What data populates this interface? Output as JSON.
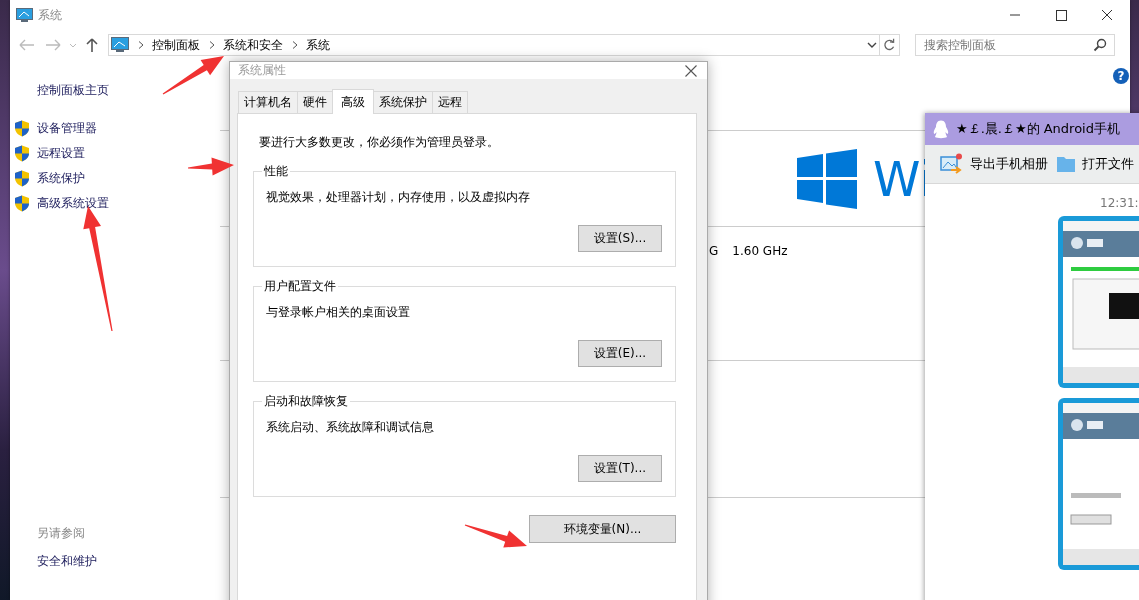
{
  "main_window": {
    "title": "系统",
    "breadcrumb": [
      "控制面板",
      "系统和安全",
      "系统"
    ],
    "search": {
      "placeholder": "搜索控制面板"
    },
    "help": "?",
    "sidebar": {
      "home": "控制面板主页",
      "items": [
        {
          "label": "设备管理器"
        },
        {
          "label": "远程设置"
        },
        {
          "label": "系统保护"
        },
        {
          "label": "高级系统设置"
        }
      ],
      "see_also": "另请参阅",
      "links": [
        "安全和维护"
      ]
    },
    "content": {
      "brand_text": "Wi",
      "processor_fragment": "G",
      "processor_speed": "1.60 GHz"
    }
  },
  "dialog": {
    "title": "系统属性",
    "tabs": [
      {
        "label": "计算机名",
        "selected": false
      },
      {
        "label": "硬件",
        "selected": false
      },
      {
        "label": "高级",
        "selected": true
      },
      {
        "label": "系统保护",
        "selected": false
      },
      {
        "label": "远程",
        "selected": false
      }
    ],
    "notice": "要进行大多数更改，你必须作为管理员登录。",
    "groups": [
      {
        "title": "性能",
        "description": "视觉效果，处理器计划，内存使用，以及虚拟内存",
        "button": "设置(S)..."
      },
      {
        "title": "用户配置文件",
        "description": "与登录帐户相关的桌面设置",
        "button": "设置(E)..."
      },
      {
        "title": "启动和故障恢复",
        "description": "系统启动、系统故障和调试信息",
        "button": "设置(T)..."
      }
    ],
    "env_button": "环境变量(N)..."
  },
  "qq_window": {
    "title": "★￡.晨.￡★的 Android手机",
    "toolbar": [
      {
        "kind": "export",
        "label": "导出手机相册"
      },
      {
        "kind": "folder",
        "label": "打开文件"
      }
    ],
    "time": "12:31:"
  }
}
